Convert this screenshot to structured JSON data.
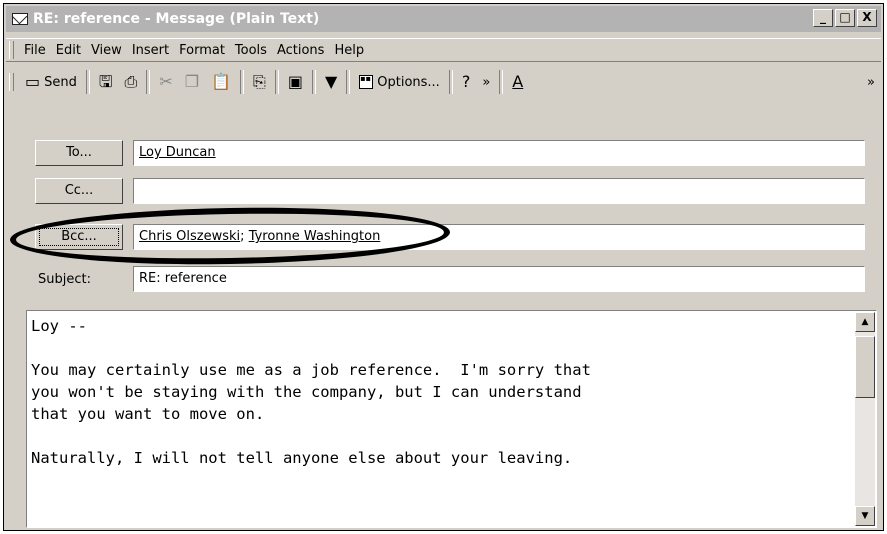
{
  "window": {
    "title": "RE: reference - Message (Plain Text)"
  },
  "titlebar_buttons": {
    "minimize": "_",
    "maximize": "□",
    "close": "X"
  },
  "menu": [
    "File",
    "Edit",
    "View",
    "Insert",
    "Format",
    "Tools",
    "Actions",
    "Help"
  ],
  "toolbar": {
    "send_label": "Send",
    "options_label": "Options...",
    "overflow": "»"
  },
  "fields": {
    "to_label": "To...",
    "to_value": "Loy Duncan",
    "cc_label": "Cc...",
    "cc_value": "",
    "bcc_label": "Bcc...",
    "bcc_value_1": "Chris Olszewski",
    "bcc_sep": "; ",
    "bcc_value_2": "Tyronne Washington",
    "subject_label": "Subject:",
    "subject_value": "RE: reference"
  },
  "body": {
    "text": "Loy --\n\nYou may certainly use me as a job reference.  I'm sorry that\nyou won't be staying with the company, but I can understand\nthat you want to move on.\n\nNaturally, I will not tell anyone else about your leaving."
  },
  "icons": [
    "envelope-icon",
    "send-icon",
    "save-icon",
    "print-icon",
    "cut-icon",
    "copy-icon",
    "paste-icon",
    "attach-icon",
    "address-book-icon",
    "flag-icon",
    "options-icon",
    "help-icon",
    "font-color-icon",
    "scroll-up-icon",
    "scroll-down-icon"
  ],
  "colors": {
    "titlebar_inactive": "#b3b3b3",
    "chrome": "#d4d0c8"
  }
}
